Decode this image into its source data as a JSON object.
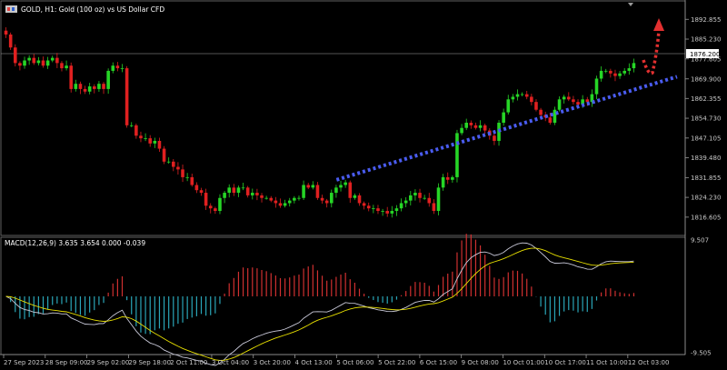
{
  "window": {
    "symbol_title": "GOLD, H1:  Gold (100 oz) vs US Dollar CFD",
    "macd_label": "MACD(12,26,9) 3.635 3.654 0.000 -0.039"
  },
  "colors": {
    "background": "#000000",
    "bull_candle": "#26d626",
    "bear_candle": "#e02020",
    "trendline": "#4a5cf0",
    "arrow": "#e23030",
    "macd_line": "#c8c8d8",
    "signal_line": "#e8e000",
    "hist_positive": "#d03030",
    "hist_negative": "#2aa6b8",
    "grid": "#888888",
    "price_tag_bg": "#ffffff"
  },
  "chart_data": [
    {
      "type": "candlestick",
      "symbol": "GOLD",
      "timeframe": "H1",
      "ylim": [
        1810.6,
        1897.5
      ],
      "y_ticks": [
        "1892.855",
        "1885.230",
        "1877.605",
        "1869.900",
        "1862.355",
        "1854.730",
        "1847.105",
        "1839.480",
        "1831.855",
        "1824.230",
        "1816.605"
      ],
      "current_price": "1876.200",
      "x_ticks": [
        "27 Sep 2023",
        "28 Sep 09:00",
        "29 Sep 02:00",
        "29 Sep 18:00",
        "2 Oct 11:00",
        "3 Oct 04:00",
        "3 Oct 20:00",
        "4 Oct 13:00",
        "5 Oct 06:00",
        "5 Oct 22:00",
        "6 Oct 15:00",
        "9 Oct 08:00",
        "10 Oct 01:00",
        "10 Oct 17:00",
        "11 Oct 10:00",
        "12 Oct 03:00"
      ],
      "closes": [
        1887,
        1882,
        1876,
        1875,
        1877,
        1878,
        1876,
        1877,
        1875,
        1877,
        1878,
        1876,
        1874,
        1875,
        1866,
        1868,
        1866,
        1865,
        1867,
        1866,
        1868,
        1866,
        1873,
        1875,
        1874,
        1874,
        1852,
        1852,
        1848,
        1847,
        1847,
        1845,
        1846,
        1843,
        1838,
        1838,
        1836,
        1835,
        1832,
        1832,
        1829,
        1827,
        1826,
        1821,
        1820,
        1819,
        1824,
        1826,
        1828,
        1826,
        1828,
        1828,
        1825,
        1826,
        1825,
        1824,
        1824,
        1823,
        1822,
        1821,
        1822,
        1823,
        1824,
        1824,
        1829,
        1828,
        1829,
        1824,
        1823,
        1822,
        1826,
        1828,
        1829,
        1830,
        1824,
        1825,
        1822,
        1821,
        1820,
        1820,
        1819,
        1819,
        1818,
        1819,
        1820,
        1822,
        1823,
        1825,
        1826,
        1824,
        1824,
        1822,
        1819,
        1828,
        1832,
        1831,
        1832,
        1849,
        1851,
        1853,
        1852,
        1851,
        1852,
        1850,
        1848,
        1846,
        1853,
        1857,
        1862,
        1863,
        1864,
        1864,
        1863,
        1861,
        1858,
        1856,
        1855,
        1853,
        1858,
        1862,
        1863,
        1862,
        1861,
        1860,
        1862,
        1861,
        1864,
        1870,
        1873,
        1873,
        1872,
        1871,
        1872,
        1873,
        1874,
        1876
      ],
      "trendline": {
        "from": [
          "5 Oct 06:00",
          1831
        ],
        "to": [
          "12 Oct 03:00",
          1865
        ]
      },
      "arrow_direction": "up"
    },
    {
      "type": "macd",
      "params": [
        12,
        26,
        9
      ],
      "values": {
        "macd": 3.635,
        "signal": 3.654,
        "histogram": 0.0,
        "difference": -0.039
      },
      "ylim": [
        -9.505,
        9.507
      ],
      "y_ticks": [
        "9.507",
        "-9.505"
      ]
    }
  ]
}
